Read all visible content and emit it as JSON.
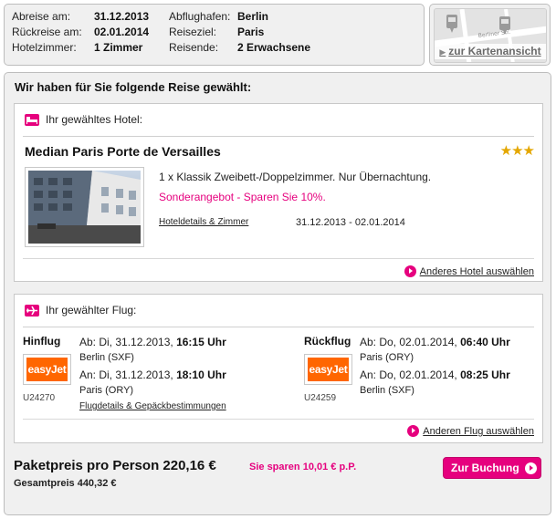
{
  "summary": {
    "departure_label": "Abreise am:",
    "departure_value": "31.12.2013",
    "return_label": "Rückreise am:",
    "return_value": "02.01.2014",
    "rooms_label": "Hotelzimmer:",
    "rooms_value": "1 Zimmer",
    "airport_label": "Abflughafen:",
    "airport_value": "Berlin",
    "destination_label": "Reiseziel:",
    "destination_value": "Paris",
    "travellers_label": "Reisende:",
    "travellers_value": "2 Erwachsene"
  },
  "map": {
    "street_label": "Berliner Str.",
    "link_label": "zur Kartenansicht"
  },
  "main": {
    "title": "Wir haben für Sie folgende Reise gewählt:"
  },
  "hotel": {
    "section_title": "Ihr gewähltes Hotel:",
    "name": "Median Paris Porte de Versailles",
    "stars": "★★★",
    "room": "1 x Klassik Zweibett-/Doppelzimmer. Nur Übernachtung.",
    "offer": "Sonderangebot - Sparen Sie 10%.",
    "details_link": "Hoteldetails & Zimmer",
    "dates": "31.12.2013 - 02.01.2014",
    "change_link": "Anderes Hotel auswählen"
  },
  "flight": {
    "section_title": "Ihr gewählter Flug:",
    "outbound": {
      "label": "Hinflug",
      "airline": "easyJet",
      "number": "U24270",
      "dep_prefix": "Ab: Di, 31.12.2013, ",
      "dep_time": "16:15 Uhr",
      "dep_city": "Berlin (SXF)",
      "arr_prefix": "An: Di, 31.12.2013, ",
      "arr_time": "18:10 Uhr",
      "arr_city": "Paris (ORY)"
    },
    "inbound": {
      "label": "Rückflug",
      "airline": "easyJet",
      "number": "U24259",
      "dep_prefix": "Ab: Do, 02.01.2014, ",
      "dep_time": "06:40 Uhr",
      "dep_city": "Paris (ORY)",
      "arr_prefix": "An: Do, 02.01.2014, ",
      "arr_time": "08:25 Uhr",
      "arr_city": "Berlin (SXF)"
    },
    "details_link": "Flugdetails & Gepäckbestimmungen",
    "change_link": "Anderen Flug auswählen"
  },
  "price": {
    "per_person": "Paketpreis pro Person 220,16 €",
    "savings": "Sie sparen 10,01 € p.P.",
    "total": "Gesamtpreis 440,32 €",
    "book_button": "Zur Buchung"
  },
  "colors": {
    "accent": "#e6007e",
    "star": "#e4a700",
    "easyjet": "#ff6600"
  }
}
